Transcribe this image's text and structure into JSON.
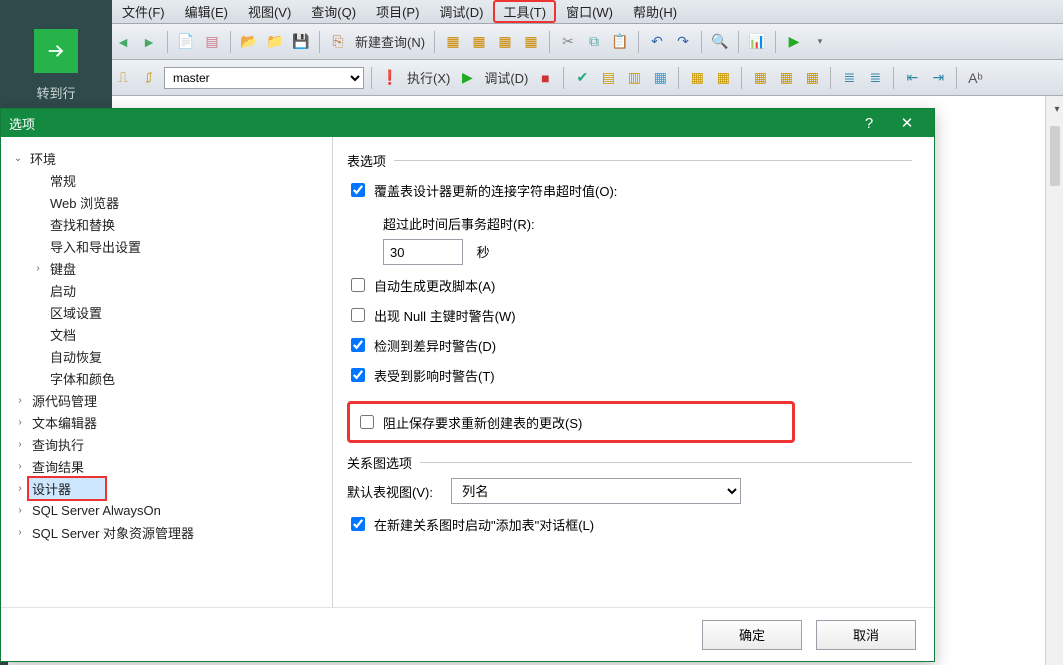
{
  "menus": {
    "file": "文件(F)",
    "edit": "编辑(E)",
    "view": "视图(V)",
    "query": "查询(Q)",
    "project": "项目(P)",
    "debug": "调试(D)",
    "tools": "工具(T)",
    "window": "窗口(W)",
    "help": "帮助(H)"
  },
  "side": {
    "goto": "转到行"
  },
  "toolbar1": {
    "newquery": "新建查询(N)"
  },
  "toolbar2": {
    "db_selected": "master",
    "execute": "执行(X)",
    "debug": "调试(D)"
  },
  "dialog": {
    "title": "选项"
  },
  "tree": {
    "env": "环境",
    "general": "常规",
    "web": "Web 浏览器",
    "find": "查找和替换",
    "importexport": "导入和导出设置",
    "keyboard": "键盘",
    "startup": "启动",
    "region": "区域设置",
    "docs": "文档",
    "autorecover": "自动恢复",
    "fonts": "字体和颜色",
    "source": "源代码管理",
    "texteditor": "文本编辑器",
    "queryexec": "查询执行",
    "queryresult": "查询结果",
    "designer": "设计器",
    "alwayson": "SQL Server AlwaysOn",
    "objexplorer": "SQL Server 对象资源管理器"
  },
  "form": {
    "group_table": "表选项",
    "chk_override": "覆盖表设计器更新的连接字符串超时值(O):",
    "timeout_label": "超过此时间后事务超时(R):",
    "timeout_value": "30",
    "seconds": "秒",
    "chk_autoscript": "自动生成更改脚本(A)",
    "chk_nullpk": "出现 Null 主键时警告(W)",
    "chk_diff": "检测到差异时警告(D)",
    "chk_affected": "表受到影响时警告(T)",
    "chk_prevent": "阻止保存要求重新创建表的更改(S)",
    "group_diagram": "关系图选项",
    "default_view_label": "默认表视图(V):",
    "default_view_value": "列名",
    "chk_addtable": "在新建关系图时启动\"添加表\"对话框(L)"
  },
  "buttons": {
    "ok": "确定",
    "cancel": "取消"
  }
}
